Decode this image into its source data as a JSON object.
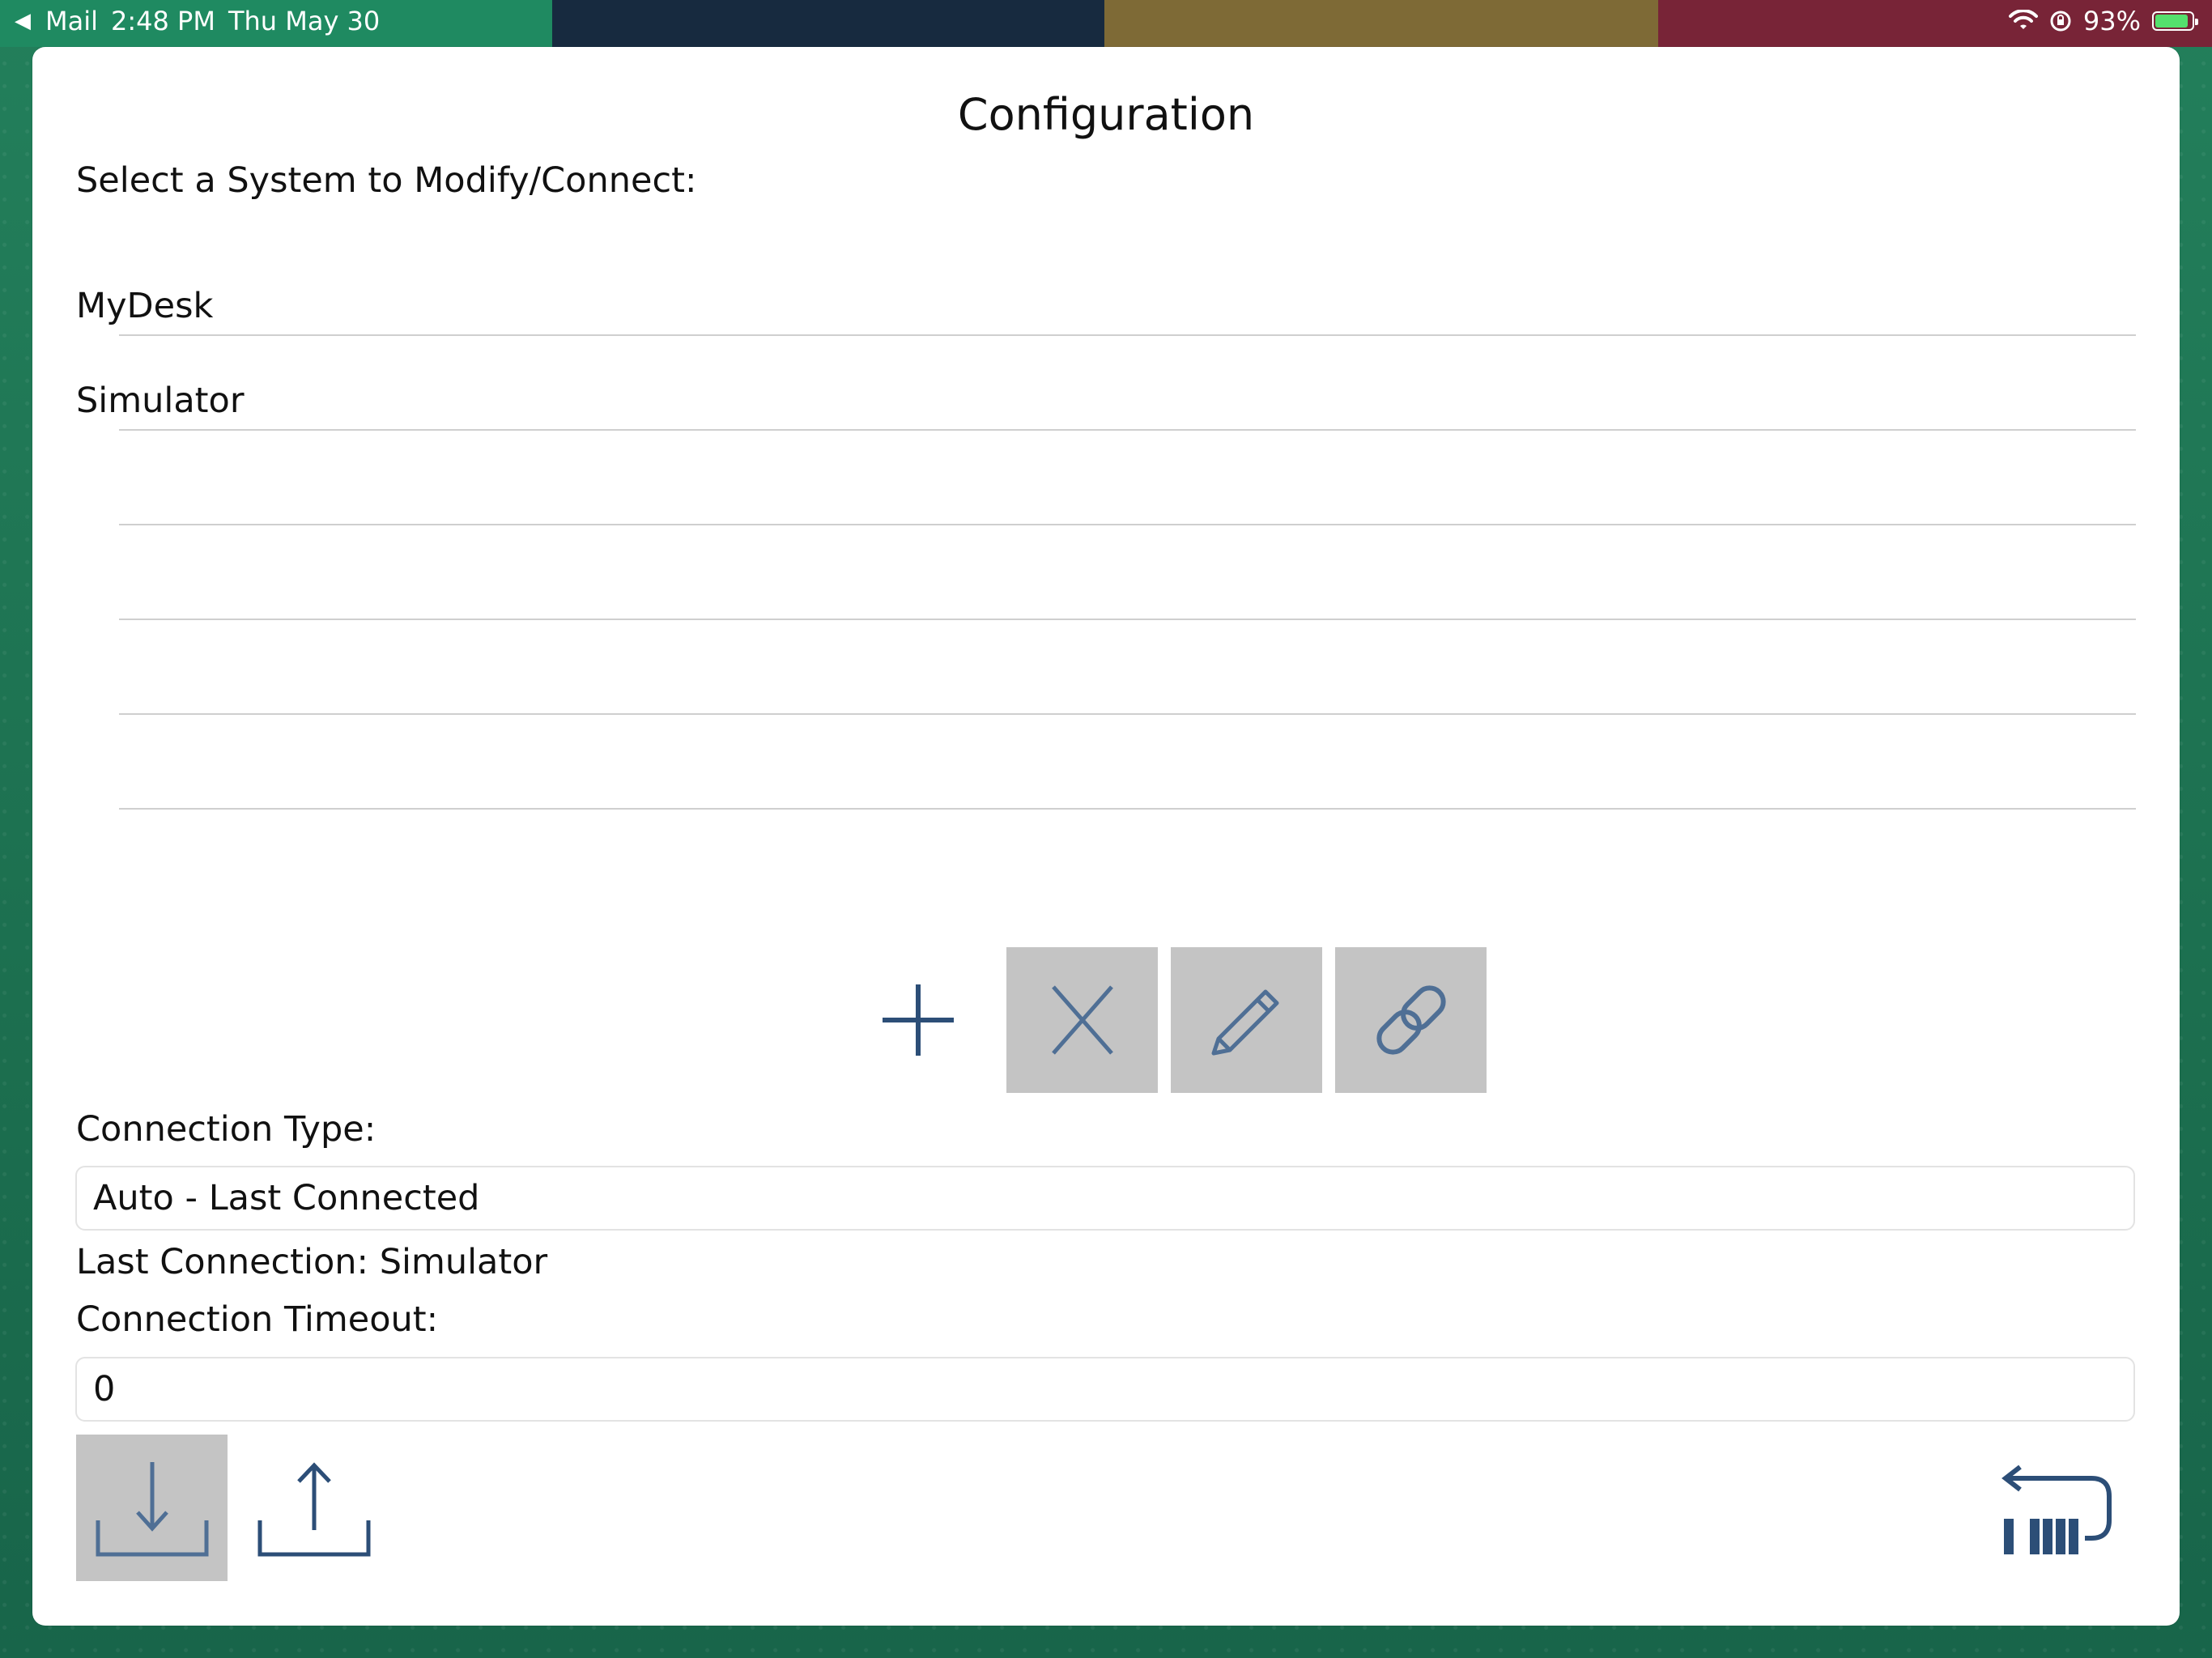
{
  "status_bar": {
    "back_app": "Mail",
    "time": "2:48 PM",
    "date": "Thu May 30",
    "battery": "93%"
  },
  "modal": {
    "title": "Configuration",
    "prompt": "Select a System to Modify/Connect:",
    "systems": [
      {
        "label": "MyDesk"
      },
      {
        "label": "Simulator"
      },
      {
        "label": ""
      },
      {
        "label": ""
      },
      {
        "label": ""
      },
      {
        "label": ""
      },
      {
        "label": ""
      },
      {
        "label": ""
      }
    ],
    "actions": {
      "add_icon": "plus-icon",
      "delete_icon": "close-icon",
      "edit_icon": "pencil-icon",
      "connect_icon": "link-icon"
    },
    "connection_type": {
      "label": "Connection Type:",
      "value": "Auto - Last Connected"
    },
    "last_connection": "Last Connection: Simulator",
    "connection_timeout": {
      "label": "Connection Timeout:",
      "value": "0"
    },
    "bottom_actions": {
      "import_icon": "download-icon",
      "export_icon": "upload-icon",
      "return_icon": "return-icon"
    }
  },
  "colors": {
    "icon": "#2c4e77",
    "icon_disabled": "#4f6f95",
    "disabled_bg": "#c4c4c4",
    "separator": "#cfcfcf"
  }
}
